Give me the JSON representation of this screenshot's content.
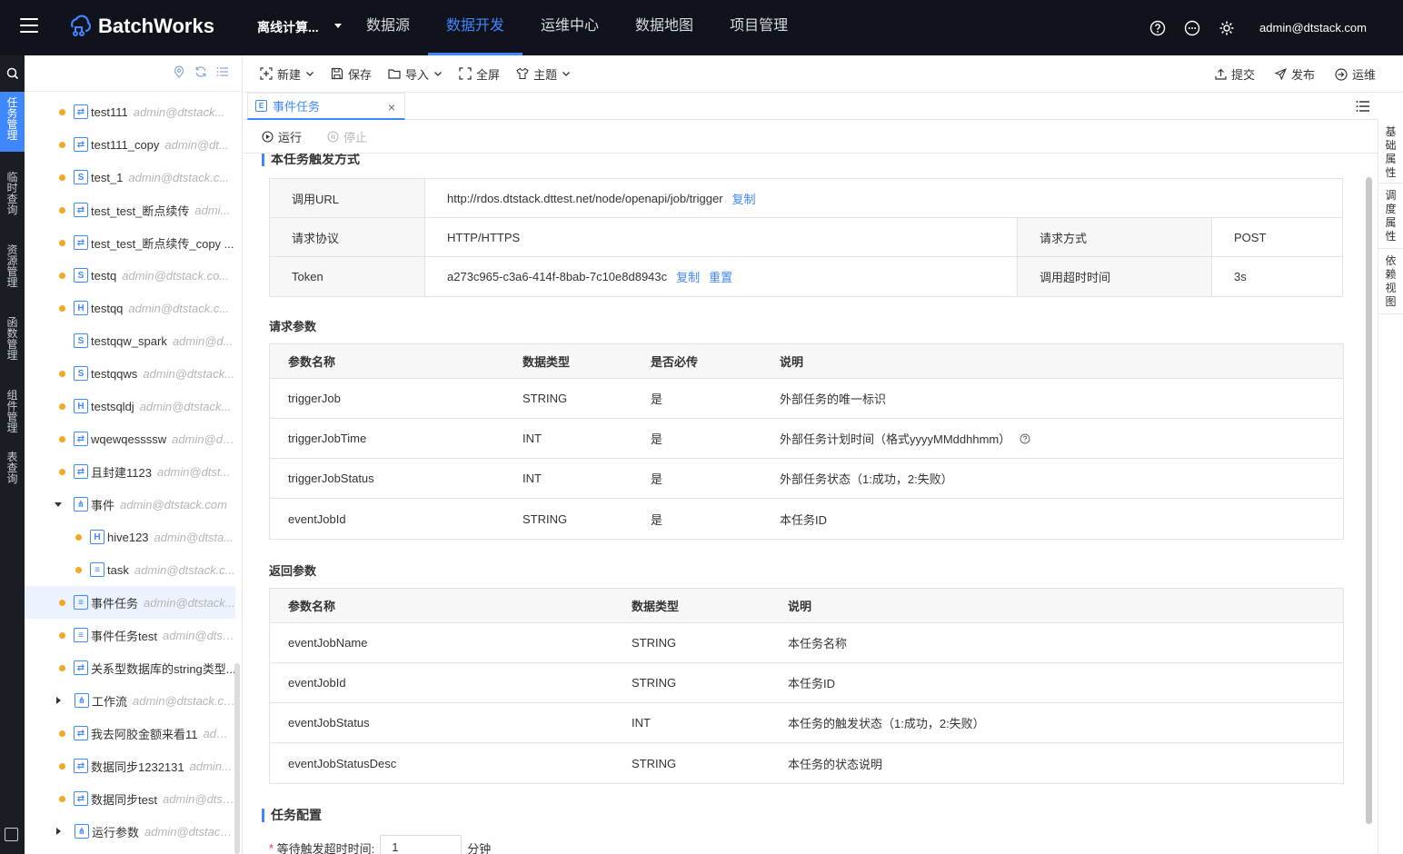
{
  "header": {
    "app_name": "BatchWorks",
    "project": "离线计算...",
    "nav": [
      "数据源",
      "数据开发",
      "运维中心",
      "数据地图",
      "项目管理"
    ],
    "active_nav": "数据开发",
    "user": "admin@dtstack.com"
  },
  "rail": [
    "任务管理",
    "临时查询",
    "资源管理",
    "函数管理",
    "组件管理",
    "表查询"
  ],
  "tree": [
    {
      "icon": "sync",
      "name": "test111",
      "meta": "admin@dtstack...",
      "dot": true
    },
    {
      "icon": "sync",
      "name": "test111_copy",
      "meta": "admin@dt...",
      "dot": true
    },
    {
      "icon": "S",
      "name": "test_1",
      "meta": "admin@dtstack.c...",
      "dot": true
    },
    {
      "icon": "sync",
      "name": "test_test_断点续传",
      "meta": "admi...",
      "dot": true
    },
    {
      "icon": "sync",
      "name": "test_test_断点续传_copy ...",
      "meta": "",
      "dot": true
    },
    {
      "icon": "S",
      "name": "testq",
      "meta": "admin@dtstack.co...",
      "dot": true
    },
    {
      "icon": "H",
      "name": "testqq",
      "meta": "admin@dtstack.c...",
      "dot": true
    },
    {
      "icon": "S",
      "name": "testqqw_spark",
      "meta": "admin@d...",
      "dot": false
    },
    {
      "icon": "S",
      "name": "testqqws",
      "meta": "admin@dtstack...",
      "dot": true
    },
    {
      "icon": "H",
      "name": "testsqldj",
      "meta": "admin@dtstack...",
      "dot": true
    },
    {
      "icon": "sync",
      "name": "wqewqessssw",
      "meta": "admin@dt...",
      "dot": true
    },
    {
      "icon": "sync",
      "name": "且封建1123",
      "meta": "admin@dtst...",
      "dot": true
    },
    {
      "icon": "flow",
      "name": "事件",
      "meta": "admin@dtstack.com",
      "dot": false,
      "folder": "open"
    },
    {
      "icon": "H",
      "name": "hive123",
      "meta": "admin@dtsta...",
      "dot": true,
      "child": true
    },
    {
      "icon": "E",
      "name": "task",
      "meta": "admin@dtstack.c...",
      "dot": true,
      "child": true
    },
    {
      "icon": "E",
      "name": "事件任务",
      "meta": "admin@dtstack...",
      "dot": true,
      "selected": true
    },
    {
      "icon": "E",
      "name": "事件任务test",
      "meta": "admin@dtst...",
      "dot": true
    },
    {
      "icon": "sync",
      "name": "关系型数据库的string类型...",
      "meta": "",
      "dot": true
    },
    {
      "icon": "flow",
      "name": "工作流",
      "meta": "admin@dtstack.com",
      "dot": false,
      "folder": "closed"
    },
    {
      "icon": "sync",
      "name": "我去阿胶金额来看11",
      "meta": "admi...",
      "dot": true
    },
    {
      "icon": "sync",
      "name": "数据同步1232131",
      "meta": "admin...",
      "dot": true
    },
    {
      "icon": "sync",
      "name": "数据同步test",
      "meta": "admin@dtst...",
      "dot": true
    },
    {
      "icon": "flow",
      "name": "运行参数",
      "meta": "admin@dtstack...",
      "dot": false,
      "folder": "closed"
    }
  ],
  "toolbar": {
    "new": "新建",
    "save": "保存",
    "import": "导入",
    "fullscreen": "全屏",
    "theme": "主题",
    "submit": "提交",
    "publish": "发布",
    "ops": "运维"
  },
  "tab": {
    "label": "事件任务"
  },
  "runbar": {
    "run": "运行",
    "stop": "停止"
  },
  "right_panel": [
    "基础属性",
    "调度属性",
    "依赖视图"
  ],
  "trigger": {
    "title": "本任务触发方式",
    "url_label": "调用URL",
    "url": "http://rdos.dtstack.dttest.net/node/openapi/job/trigger",
    "copy": "复制",
    "protocol_label": "请求协议",
    "protocol": "HTTP/HTTPS",
    "method_label": "请求方式",
    "method": "POST",
    "token_label": "Token",
    "token": "a273c965-c3a6-414f-8bab-7c10e8d8943c",
    "reset": "重置",
    "timeout_label": "调用超时时间",
    "timeout": "3s"
  },
  "request_params": {
    "title": "请求参数",
    "headers": [
      "参数名称",
      "数据类型",
      "是否必传",
      "说明"
    ],
    "rows": [
      [
        "triggerJob",
        "STRING",
        "是",
        "外部任务的唯一标识"
      ],
      [
        "triggerJobTime",
        "INT",
        "是",
        "外部任务计划时间（格式yyyyMMddhhmm）"
      ],
      [
        "triggerJobStatus",
        "INT",
        "是",
        "外部任务状态（1:成功，2:失败）"
      ],
      [
        "eventJobId",
        "STRING",
        "是",
        "本任务ID"
      ]
    ]
  },
  "response_params": {
    "title": "返回参数",
    "headers": [
      "参数名称",
      "数据类型",
      "说明"
    ],
    "rows": [
      [
        "eventJobName",
        "STRING",
        "本任务名称"
      ],
      [
        "eventJobId",
        "STRING",
        "本任务ID"
      ],
      [
        "eventJobStatus",
        "INT",
        "本任务的触发状态（1:成功，2:失败）"
      ],
      [
        "eventJobStatusDesc",
        "STRING",
        "本任务的状态说明"
      ]
    ]
  },
  "task_config": {
    "title": "任务配置",
    "wait_label": "等待触发超时时间:",
    "wait_value": "1",
    "wait_unit": "分钟"
  }
}
